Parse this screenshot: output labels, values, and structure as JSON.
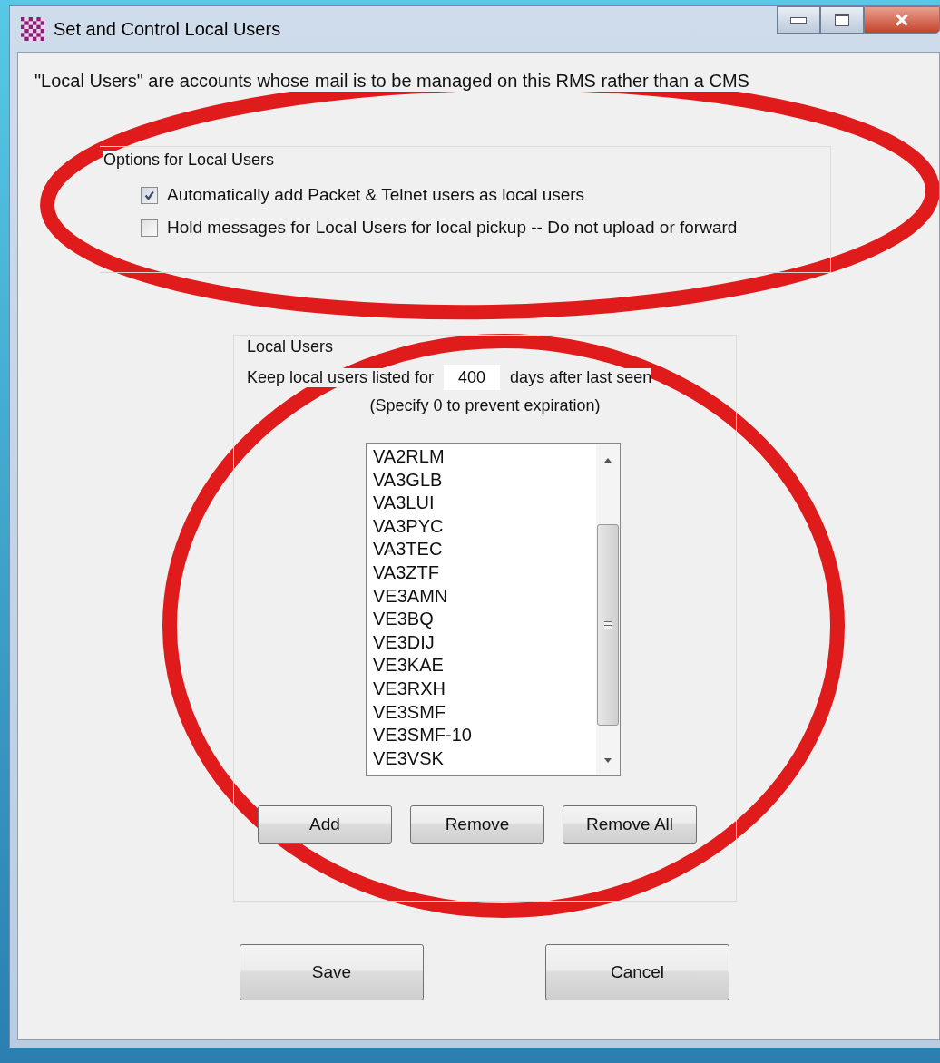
{
  "window": {
    "title": "Set and Control Local Users"
  },
  "intro": "\"Local Users\" are accounts whose mail is to be managed on this RMS rather than a CMS",
  "options_group": {
    "title": "Options for Local Users",
    "options": [
      {
        "label": "Automatically add Packet & Telnet users as local users",
        "checked": true
      },
      {
        "label": "Hold messages for Local Users for local pickup -- Do not upload or forward",
        "checked": false
      }
    ]
  },
  "users_group": {
    "title": "Local Users",
    "keep_before": "Keep local users listed for",
    "keep_days": "400",
    "keep_after": "days after last seen",
    "hint": "(Specify 0 to prevent expiration)",
    "users": [
      "VA2RLM",
      "VA3GLB",
      "VA3LUI",
      "VA3PYC",
      "VA3TEC",
      "VA3ZTF",
      "VE3AMN",
      "VE3BQ",
      "VE3DIJ",
      "VE3KAE",
      "VE3RXH",
      "VE3SMF",
      "VE3SMF-10",
      "VE3VSK"
    ],
    "buttons": [
      "Add",
      "Remove",
      "Remove All"
    ]
  },
  "buttons": [
    "Save",
    "Cancel"
  ]
}
